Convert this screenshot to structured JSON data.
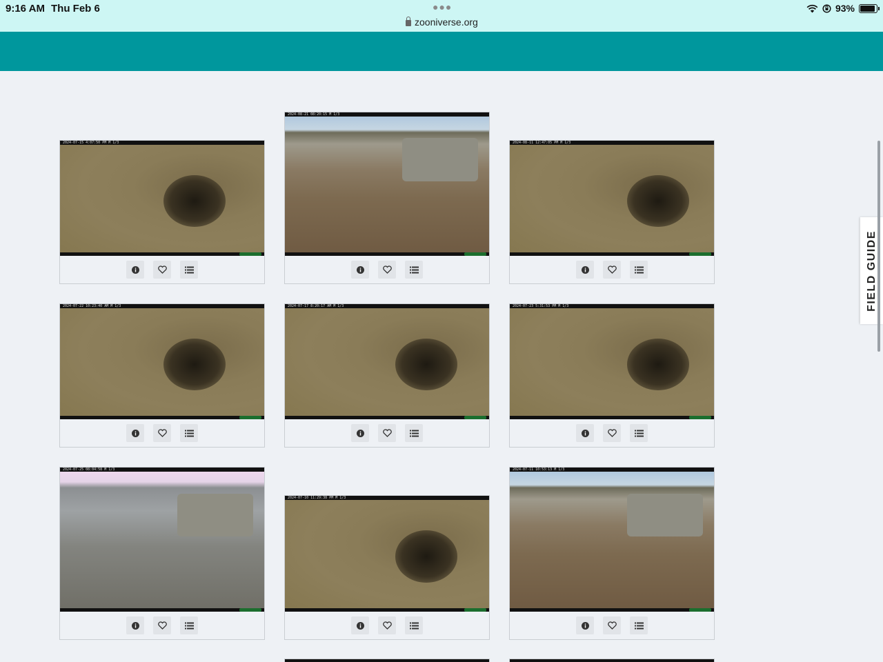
{
  "status_bar": {
    "time": "9:16 AM",
    "date": "Thu Feb 6",
    "url": "zooniverse.org",
    "battery": "93%",
    "battery_level": 0.93
  },
  "field_guide_label": "FIELD GUIDE",
  "subjects": [
    {
      "stamp": "2024-07-15 4:07:50 PM  M 1/3",
      "scene": "burrow"
    },
    {
      "stamp": "2024-08-21 08:20:15  M 1/3",
      "scene": "rocks"
    },
    {
      "stamp": "2024-08-11 12:47:05 PM  M 1/3",
      "scene": "burrow"
    },
    {
      "stamp": "2024-07-22 10:23:40 AM  M 1/3",
      "scene": "burrow"
    },
    {
      "stamp": "2024-07-17 8:20:17 AM  M 1/3",
      "scene": "burrow"
    },
    {
      "stamp": "2024-07-23 5:31:53 PM  M 1/3",
      "scene": "burrow"
    },
    {
      "stamp": "2024-07-25 08:04:58  M 1/3",
      "scene": "rocks-dusk"
    },
    {
      "stamp": "2024-07-10 11:29:38 PM  M 1/3",
      "scene": "burrow"
    },
    {
      "stamp": "2024-07-11 10:53:13  M 1/3",
      "scene": "rocks"
    }
  ],
  "colors": {
    "status_bar": "#cdf6f4",
    "header": "#00979d",
    "page_bg": "#eef1f5"
  }
}
